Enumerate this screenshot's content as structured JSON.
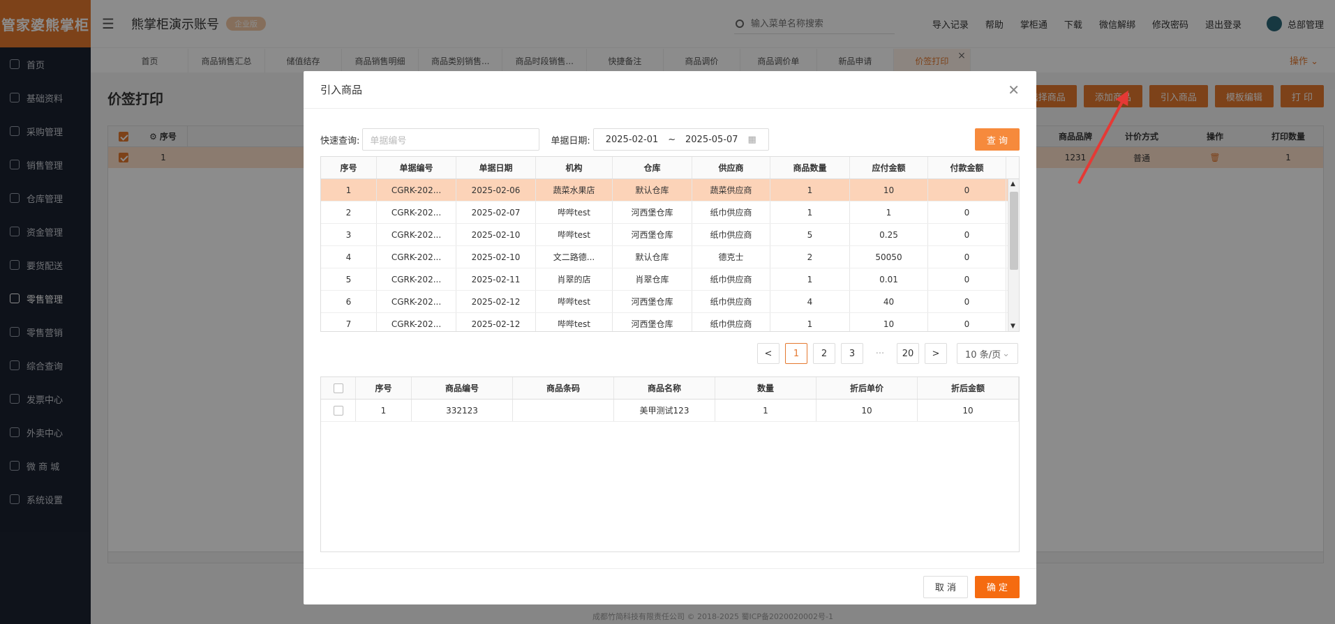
{
  "sidebar": {
    "logo": "管家婆熊掌柜",
    "items": [
      {
        "label": "首页",
        "icon": "globe-icon"
      },
      {
        "label": "基础资料",
        "icon": "home-icon"
      },
      {
        "label": "采购管理",
        "icon": "cart-icon"
      },
      {
        "label": "销售管理",
        "icon": "sales-icon"
      },
      {
        "label": "仓库管理",
        "icon": "warehouse-icon"
      },
      {
        "label": "资金管理",
        "icon": "money-icon"
      },
      {
        "label": "要货配送",
        "icon": "delivery-icon"
      },
      {
        "label": "零售管理",
        "icon": "retail-chart-icon"
      },
      {
        "label": "零售营销",
        "icon": "gift-icon"
      },
      {
        "label": "综合查询",
        "icon": "bar-chart-icon"
      },
      {
        "label": "发票中心",
        "icon": "invoice-icon"
      },
      {
        "label": "外卖中心",
        "icon": "takeout-icon"
      },
      {
        "label": "微 商 城",
        "icon": "shop-bag-icon"
      },
      {
        "label": "系统设置",
        "icon": "gear-icon"
      }
    ]
  },
  "header": {
    "shop_name": "熊掌柜演示账号",
    "vip_badge": "企业版",
    "search_placeholder": "输入菜单名称搜索",
    "links": [
      "导入记录",
      "帮助",
      "掌柜通",
      "下载",
      "微信解绑",
      "修改密码",
      "退出登录"
    ],
    "user": "总部管理"
  },
  "tabs": [
    "首页",
    "商品销售汇总",
    "储值结存",
    "商品销售明细",
    "商品类别销售...",
    "商品时段销售...",
    "快捷备注",
    "商品调价",
    "商品调价单",
    "新品申请",
    "价签打印"
  ],
  "ops_label": "操作",
  "page": {
    "title": "价签打印",
    "buttons": [
      "选择商品",
      "添加商品",
      "引入商品",
      "模板编辑",
      "打 印"
    ],
    "table_headers_left": [
      "序号"
    ],
    "table_headers_right": [
      "商品品牌",
      "计价方式",
      "操作",
      "打印数量"
    ],
    "row": {
      "index": "1",
      "brand": "1231",
      "pricing": "普通",
      "qty": "1"
    },
    "footer": "成都竹简科技有限责任公司 © 2018-2025 蜀ICP备2020020002号-1"
  },
  "modal": {
    "title": "引入商品",
    "quick_label": "快速查询:",
    "quick_placeholder": "单据编号",
    "date_label": "单据日期:",
    "date_from": "2025-02-01",
    "date_sep": "~",
    "date_to": "2025-05-07",
    "query_btn": "查 询",
    "orders_headers": [
      "序号",
      "单据编号",
      "单据日期",
      "机构",
      "仓库",
      "供应商",
      "商品数量",
      "应付金额",
      "付款金额"
    ],
    "orders": [
      [
        "1",
        "CGRK-202...",
        "2025-02-06",
        "蔬菜水果店",
        "默认仓库",
        "蔬菜供应商",
        "1",
        "10",
        "0"
      ],
      [
        "2",
        "CGRK-202...",
        "2025-02-07",
        "哔哔test",
        "河西堡仓库",
        "纸巾供应商",
        "1",
        "1",
        "0"
      ],
      [
        "3",
        "CGRK-202...",
        "2025-02-10",
        "哔哔test",
        "河西堡仓库",
        "纸巾供应商",
        "5",
        "0.25",
        "0"
      ],
      [
        "4",
        "CGRK-202...",
        "2025-02-10",
        "文二路德...",
        "默认仓库",
        "德克士",
        "2",
        "50050",
        "0"
      ],
      [
        "5",
        "CGRK-202...",
        "2025-02-11",
        "肖翠的店",
        "肖翠仓库",
        "纸巾供应商",
        "1",
        "0.01",
        "0"
      ],
      [
        "6",
        "CGRK-202...",
        "2025-02-12",
        "哔哔test",
        "河西堡仓库",
        "纸巾供应商",
        "4",
        "40",
        "0"
      ],
      [
        "7",
        "CGRK-202...",
        "2025-02-12",
        "哔哔test",
        "河西堡仓库",
        "纸巾供应商",
        "1",
        "10",
        "0"
      ]
    ],
    "pager": {
      "prev": "<",
      "pages": [
        "1",
        "2",
        "3"
      ],
      "dots": "···",
      "last": "20",
      "next": ">",
      "size": "10 条/页"
    },
    "items_headers": [
      "序号",
      "商品编号",
      "商品条码",
      "商品名称",
      "数量",
      "折后单价",
      "折后金额"
    ],
    "items": [
      [
        "1",
        "332123",
        "",
        "美甲测试123",
        "1",
        "10",
        "10"
      ]
    ],
    "cancel_btn": "取 消",
    "ok_btn": "确 定"
  }
}
